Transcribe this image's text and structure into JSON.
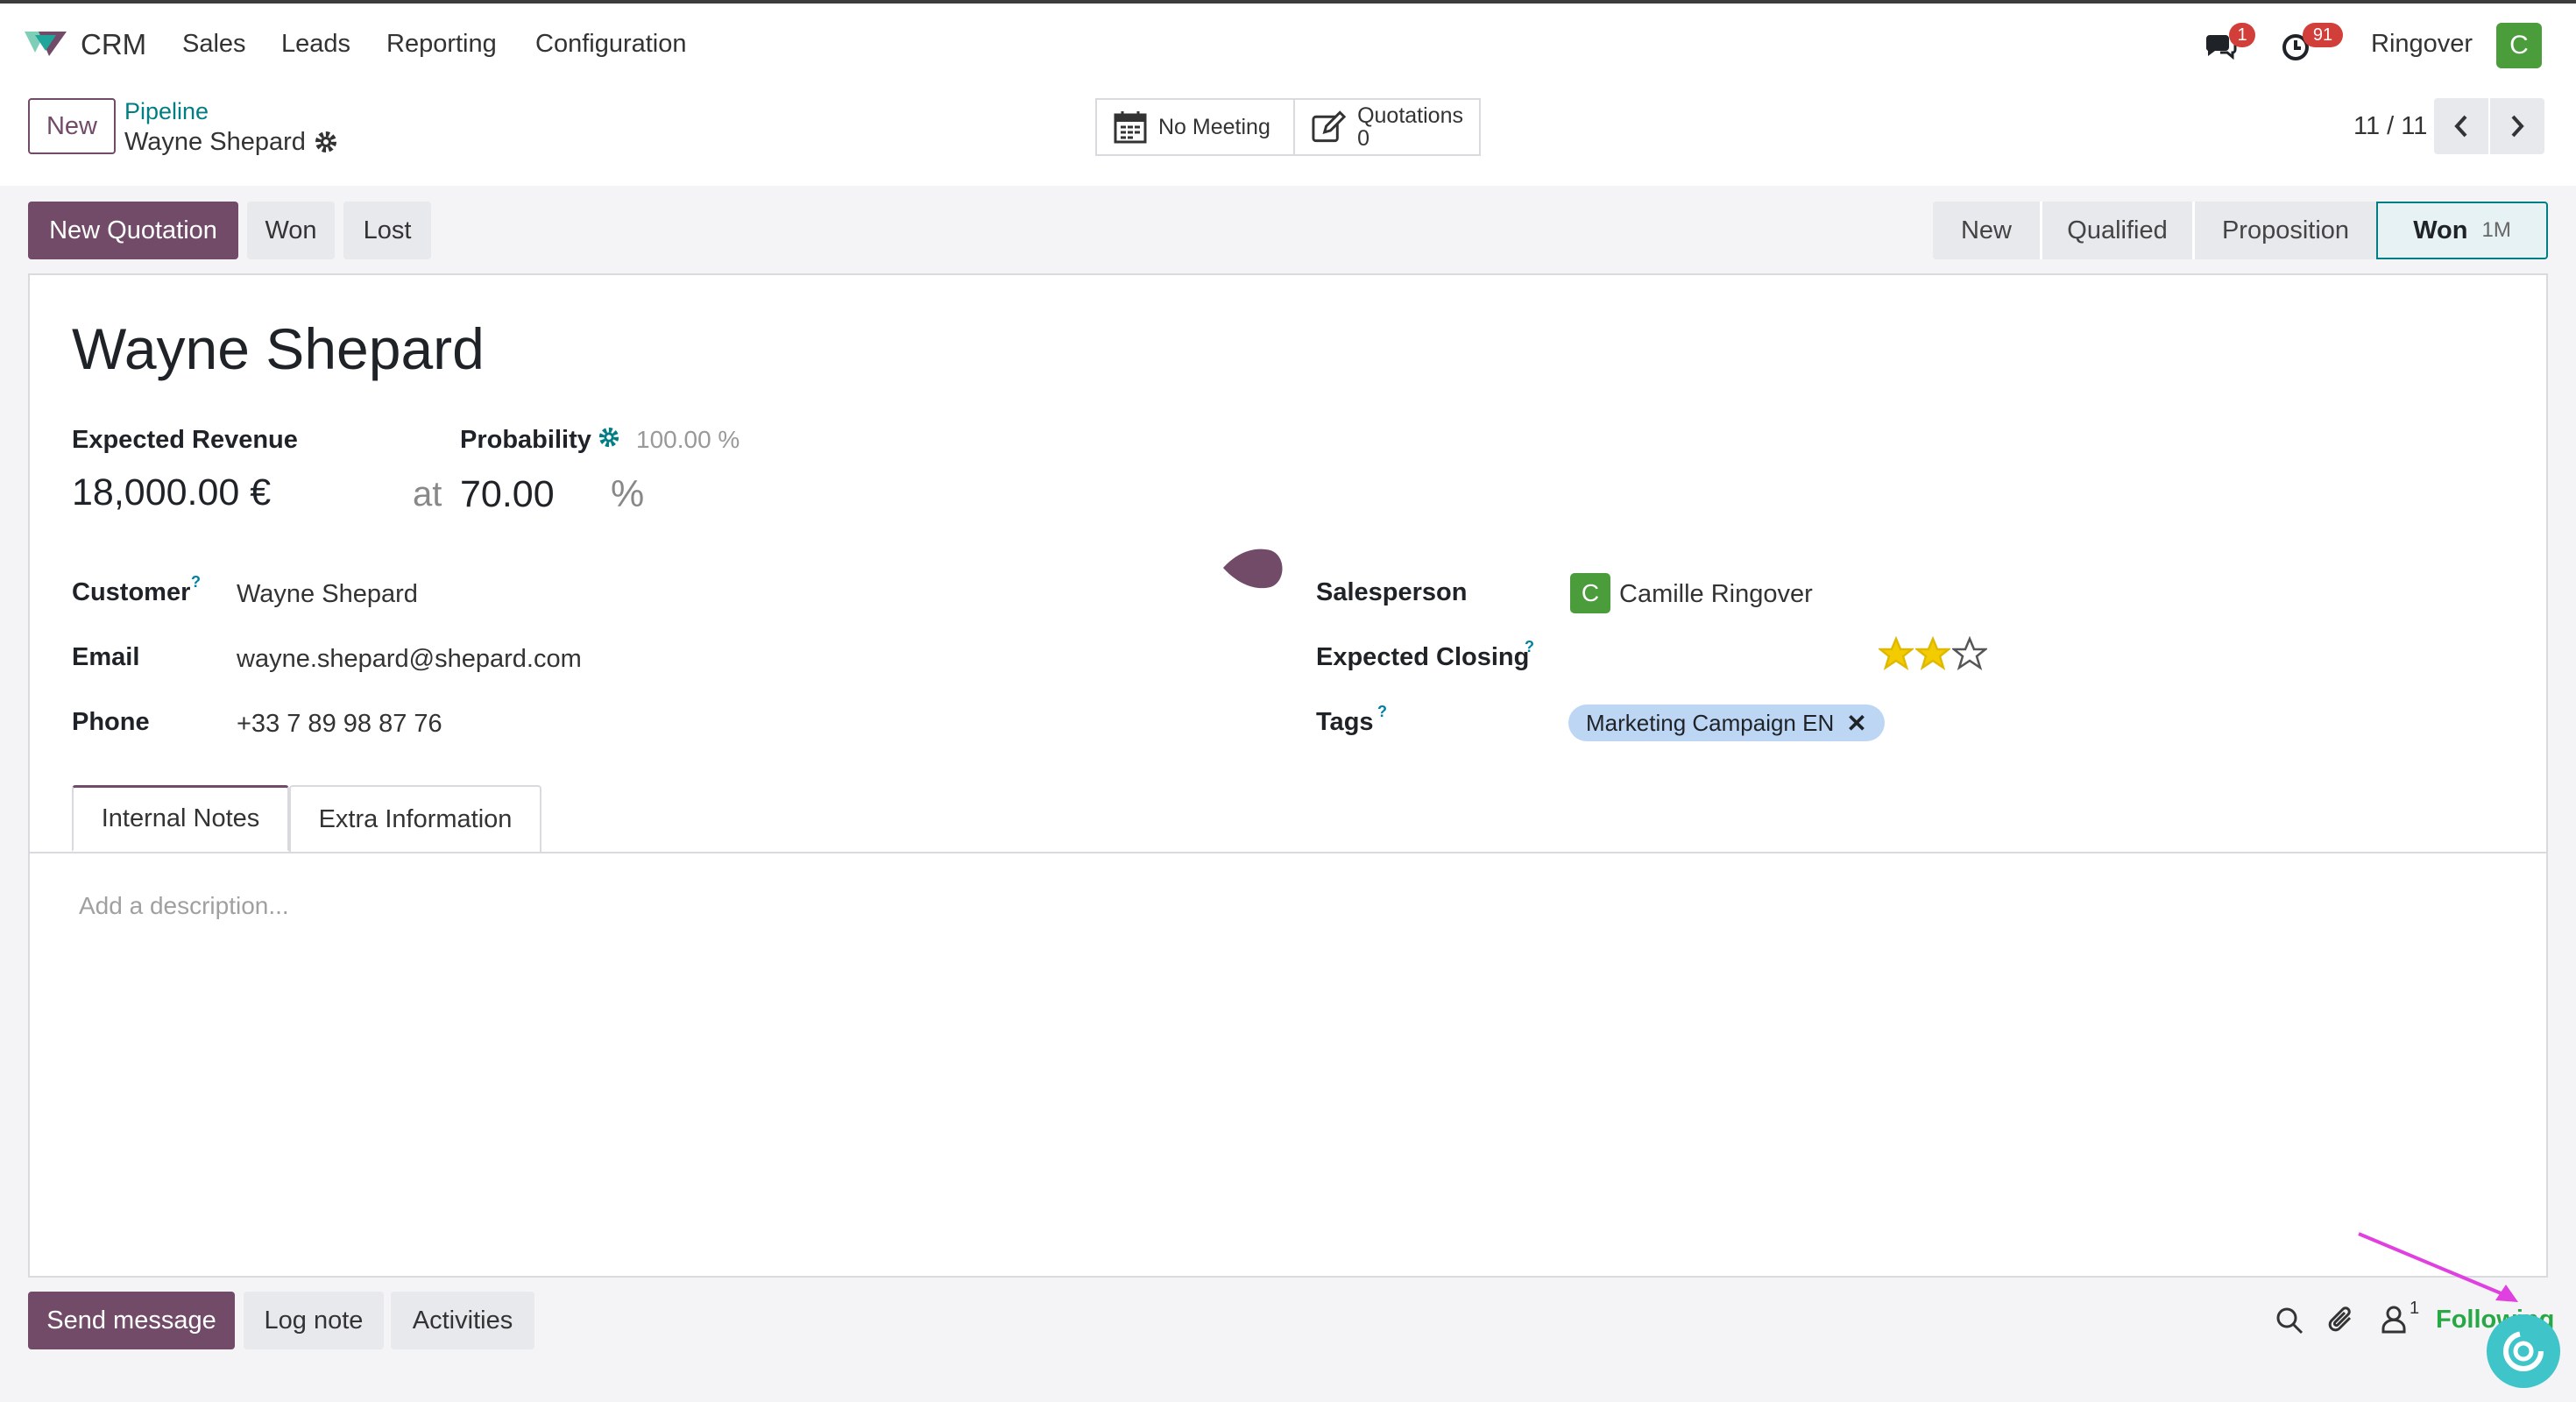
{
  "nav": {
    "app": "CRM",
    "menu": [
      "Sales",
      "Leads",
      "Reporting",
      "Configuration"
    ],
    "messages_badge": "1",
    "activities_badge": "91",
    "company": "Ringover",
    "avatar_letter": "C"
  },
  "control": {
    "new_label": "New",
    "breadcrumb_parent": "Pipeline",
    "breadcrumb_current": "Wayne Shepard",
    "meeting_label": "No Meeting",
    "quotations_label": "Quotations",
    "quotations_count": "0",
    "pager": "11 / 11"
  },
  "actions": {
    "new_quotation": "New Quotation",
    "won": "Won",
    "lost": "Lost"
  },
  "stages": [
    {
      "label": "New"
    },
    {
      "label": "Qualified"
    },
    {
      "label": "Proposition"
    },
    {
      "label": "Won",
      "tag": "1M"
    }
  ],
  "record": {
    "name": "Wayne Shepard",
    "expected_revenue_label": "Expected Revenue",
    "probability_label": "Probability",
    "probability_auto": "100.00 %",
    "revenue": "18,000.00 €",
    "at": "at",
    "probability": "70.00",
    "percent": "%",
    "customer_label": "Customer",
    "customer": "Wayne Shepard",
    "email_label": "Email",
    "email": "wayne.shepard@shepard.com",
    "phone_label": "Phone",
    "phone": "+33 7 89 98 87 76",
    "salesperson_label": "Salesperson",
    "salesperson": "Camille Ringover",
    "salesperson_initial": "C",
    "expected_closing_label": "Expected Closing",
    "priority_stars": 2,
    "priority_max": 3,
    "tags_label": "Tags",
    "tag": "Marketing Campaign EN",
    "help_mark": "?"
  },
  "tabs": [
    "Internal Notes",
    "Extra Information"
  ],
  "notes_placeholder": "Add a description...",
  "chatter": {
    "send_message": "Send message",
    "log_note": "Log note",
    "activities": "Activities",
    "followers_count": "1",
    "following": "Following"
  },
  "colors": {
    "brand": "#714b67",
    "link": "#017e84",
    "star": "#f3cc00",
    "tag_bg": "#bcd6f3",
    "annotation_arrow": "#e040e0"
  }
}
